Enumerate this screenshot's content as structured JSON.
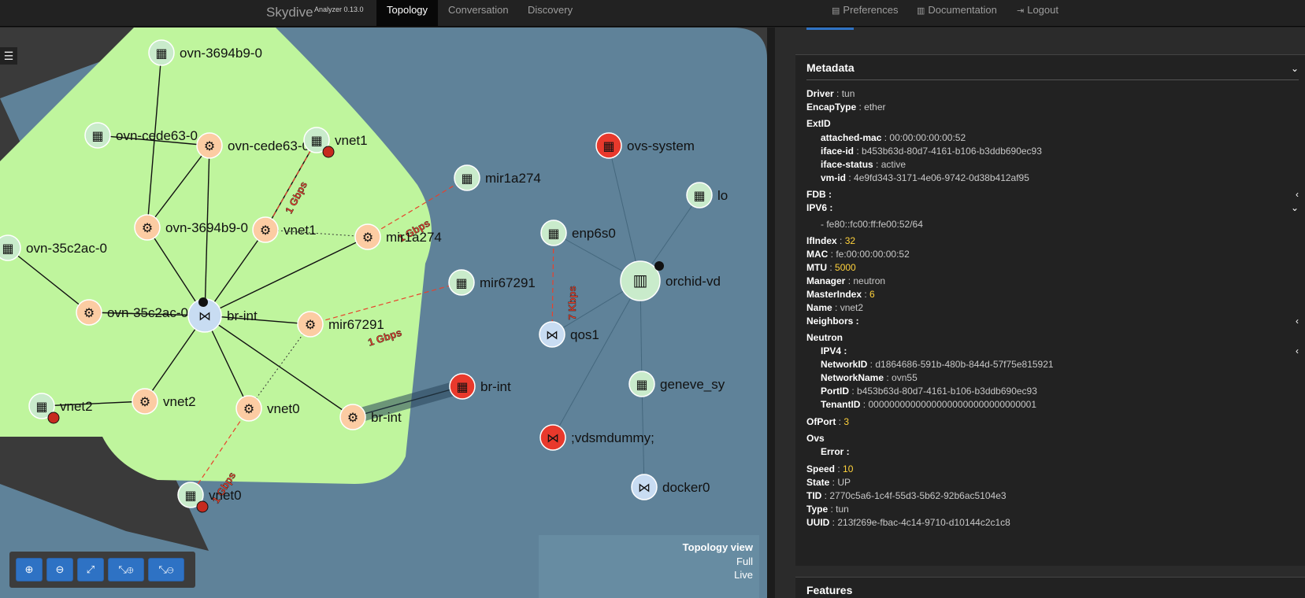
{
  "navbar": {
    "brand": "Skydive",
    "brand_sub": "Analyzer 0.13.0",
    "tabs": [
      {
        "label": "Topology",
        "active": true
      },
      {
        "label": "Conversation",
        "active": false
      },
      {
        "label": "Discovery",
        "active": false
      }
    ],
    "links": [
      {
        "label": "Preferences",
        "icon": "file-icon"
      },
      {
        "label": "Documentation",
        "icon": "book-icon"
      },
      {
        "label": "Logout",
        "icon": "logout-icon"
      }
    ]
  },
  "topology": {
    "nodes": [
      {
        "name": "ovn-3694b9-0",
        "type": "interface",
        "state": "up"
      },
      {
        "name": "ovn-cede63-0",
        "type": "interface",
        "state": "up"
      },
      {
        "name": "ovn-cede63-0",
        "type": "ovsport",
        "state": "up"
      },
      {
        "name": "vnet1",
        "type": "interface",
        "state": "down"
      },
      {
        "name": "ovn-3694b9-0",
        "type": "ovsport",
        "state": "up"
      },
      {
        "name": "vnet1",
        "type": "ovsport",
        "state": "up"
      },
      {
        "name": "mir1a274",
        "type": "ovsport",
        "state": "up"
      },
      {
        "name": "mir1a274",
        "type": "interface",
        "state": "up"
      },
      {
        "name": "ovn-35c2ac-0",
        "type": "interface",
        "state": "up"
      },
      {
        "name": "ovn-35c2ac-0",
        "type": "ovsport",
        "state": "up"
      },
      {
        "name": "br-int",
        "type": "bridge",
        "state": "up"
      },
      {
        "name": "mir67291",
        "type": "ovsport",
        "state": "up"
      },
      {
        "name": "mir67291",
        "type": "interface",
        "state": "up"
      },
      {
        "name": "vnet2",
        "type": "interface",
        "state": "down"
      },
      {
        "name": "vnet2",
        "type": "ovsport",
        "state": "up"
      },
      {
        "name": "vnet0",
        "type": "ovsport",
        "state": "up"
      },
      {
        "name": "br-int",
        "type": "ovsport",
        "state": "up"
      },
      {
        "name": "br-int",
        "type": "interface",
        "state": "down"
      },
      {
        "name": "vnet0",
        "type": "interface",
        "state": "down"
      },
      {
        "name": "ovs-system",
        "type": "interface",
        "state": "down"
      },
      {
        "name": "enp6s0",
        "type": "interface",
        "state": "up"
      },
      {
        "name": "orchid-vd",
        "type": "host",
        "state": "up"
      },
      {
        "name": "qos1",
        "type": "bridge",
        "state": "up"
      },
      {
        "name": "geneve_sy",
        "type": "interface",
        "state": "up"
      },
      {
        "name": ";vdsmdummy;",
        "type": "bridge",
        "state": "down"
      },
      {
        "name": "docker0",
        "type": "bridge",
        "state": "up"
      },
      {
        "name": "lo",
        "type": "interface",
        "state": "up"
      }
    ],
    "link_labels": [
      "1 Gbps",
      "1 Gbps",
      "1 Gbps",
      "1 Gbps",
      "7 Kbps"
    ],
    "view": {
      "title": "Topology view",
      "line1": "Full",
      "line2": "Live"
    },
    "zoom_controls": [
      {
        "icon": "zoom-in-icon",
        "glyph": "⊕"
      },
      {
        "icon": "zoom-out-icon",
        "glyph": "⊖"
      },
      {
        "icon": "fit-icon",
        "glyph": "⤢"
      },
      {
        "icon": "expand-icon",
        "glyph": "⤡⊕"
      },
      {
        "icon": "collapse-icon",
        "glyph": "⤡⊖"
      }
    ],
    "menu_glyph": "☰",
    "colors": {
      "host_group": "#5f8299",
      "bridge_group": "#bff59d",
      "ovsport_fill": "#fccca3",
      "interface_fill": "#c9ebcb",
      "down_fill": "#e8392c",
      "bridge_fill": "#c8dcf2",
      "link_label": "#e8412c"
    }
  },
  "metadata": {
    "title": "Metadata",
    "driver": {
      "key": "Driver",
      "value": "tun"
    },
    "encap": {
      "key": "EncapType",
      "value": "ether"
    },
    "extid": {
      "key": "ExtID"
    },
    "attached_mac": {
      "key": "attached-mac",
      "value": "00:00:00:00:00:52"
    },
    "iface_id": {
      "key": "iface-id",
      "value": "b453b63d-80d7-4161-b106-b3ddb690ec93"
    },
    "iface_status": {
      "key": "iface-status",
      "value": "active"
    },
    "vm_id": {
      "key": "vm-id",
      "value": "4e9fd343-3171-4e06-9742-0d38b412af95"
    },
    "fdb": {
      "key": "FDB :"
    },
    "ipv6": {
      "key": "IPV6 :",
      "value": "- fe80::fc00:ff:fe00:52/64"
    },
    "ifindex": {
      "key": "IfIndex",
      "value": "32"
    },
    "mac": {
      "key": "MAC",
      "value": "fe:00:00:00:00:52"
    },
    "mtu": {
      "key": "MTU",
      "value": "5000"
    },
    "manager": {
      "key": "Manager",
      "value": "neutron"
    },
    "masterindex": {
      "key": "MasterIndex",
      "value": "6"
    },
    "name": {
      "key": "Name",
      "value": "vnet2"
    },
    "neighbors": {
      "key": "Neighbors :"
    },
    "neutron": {
      "key": "Neutron"
    },
    "ipv4": {
      "key": "IPV4 :"
    },
    "network_id": {
      "key": "NetworkID",
      "value": "d1864686-591b-480b-844d-57f75e815921"
    },
    "network_name": {
      "key": "NetworkName",
      "value": "ovn55"
    },
    "port_id": {
      "key": "PortID",
      "value": "b453b63d-80d7-4161-b106-b3ddb690ec93"
    },
    "tenant_id": {
      "key": "TenantID",
      "value": "00000000000000000000000000000001"
    },
    "ofport": {
      "key": "OfPort",
      "value": "3"
    },
    "ovs": {
      "key": "Ovs"
    },
    "error": {
      "key": "Error :"
    },
    "speed": {
      "key": "Speed",
      "value": "10"
    },
    "state": {
      "key": "State",
      "value": "UP"
    },
    "tid": {
      "key": "TID",
      "value": "2770c5a6-1c4f-55d3-5b62-92b6ac5104e3"
    },
    "type": {
      "key": "Type",
      "value": "tun"
    },
    "uuid": {
      "key": "UUID",
      "value": "213f269e-fbac-4c14-9710-d10144c2c1c8"
    }
  },
  "features": {
    "title": "Features"
  }
}
